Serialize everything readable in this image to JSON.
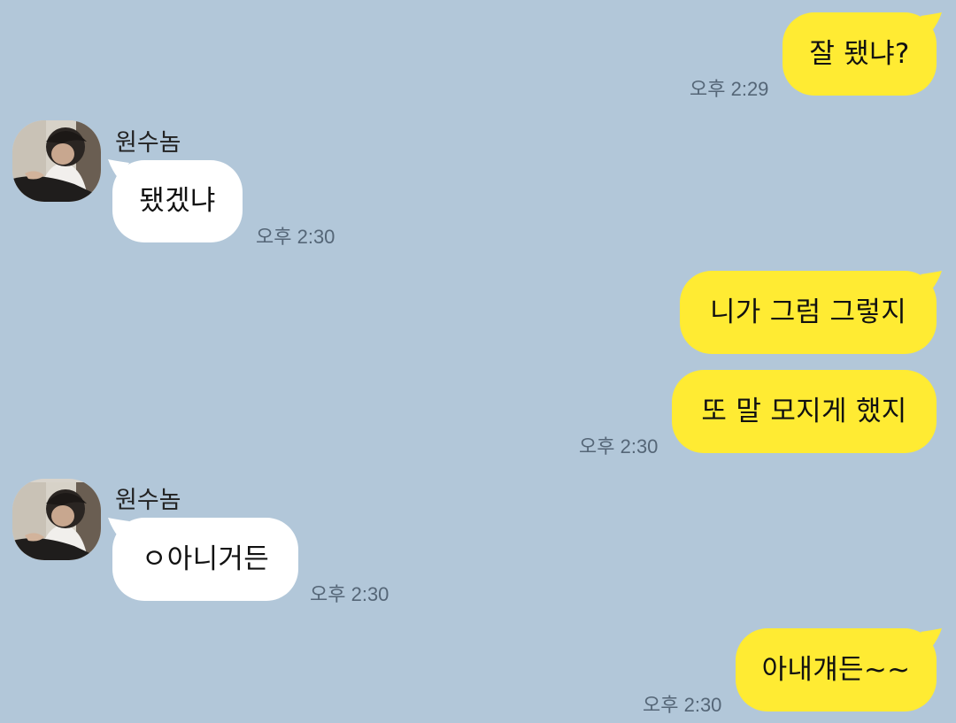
{
  "chat": {
    "background_color": "#b2c7d9",
    "my_bubble_color": "#ffeb33",
    "their_bubble_color": "#ffffff",
    "messages": [
      {
        "text": "잘 됐냐?",
        "time": "오후 2:29"
      },
      {
        "sender": "원수놈",
        "text": "됐겠냐",
        "time": "오후 2:30"
      },
      {
        "text": "니가 그럼 그렇지"
      },
      {
        "text": "또 말 모지게 했지",
        "time": "오후 2:30"
      },
      {
        "sender": "원수놈",
        "text": "ㅇ아니거든",
        "time": "오후 2:30"
      },
      {
        "text": "아내걔든~~",
        "time": "오후 2:30"
      }
    ]
  }
}
